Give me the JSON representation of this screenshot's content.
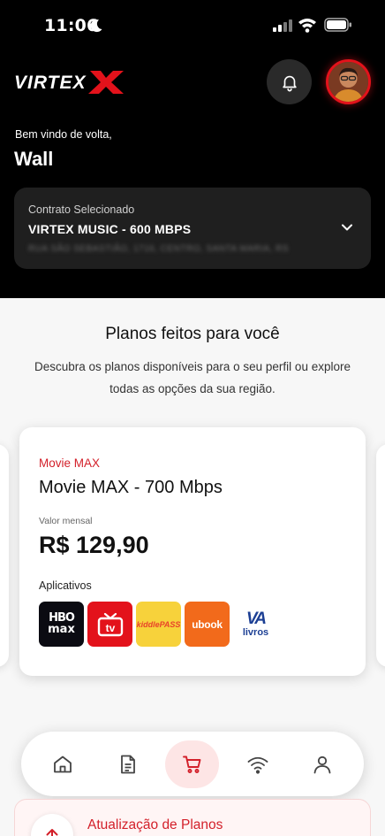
{
  "status_bar": {
    "time": "11:06"
  },
  "header": {
    "logo_text": "VIRTEX",
    "welcome": "Bem vindo de volta,",
    "user_name": "Wall"
  },
  "contract": {
    "label": "Contrato Selecionado",
    "plan": "VIRTEX MUSIC - 600 MBPS",
    "address": "RUA SÃO SEBASTIÃO, 1716, CENTRO, SANTA MARIA, RS"
  },
  "plans_section": {
    "title": "Planos feitos para você",
    "subtitle": "Descubra os planos disponíveis para o seu perfil ou explore todas as opções da sua região."
  },
  "plan_card": {
    "tag": "Movie MAX",
    "title": "Movie MAX - 700 Mbps",
    "value_label": "Valor mensal",
    "price": "R$ 129,90",
    "apps_label": "Aplicativos",
    "apps": [
      {
        "name": "HBO Max",
        "line1": "HBO",
        "line2": "max"
      },
      {
        "name": "TV",
        "glyph": "tv"
      },
      {
        "name": "kiddle",
        "text": "kiddlePASS"
      },
      {
        "name": "ubook",
        "text": "ubook"
      },
      {
        "name": "VA livros",
        "line1": "VA",
        "line2": "livros"
      }
    ]
  },
  "nav": {
    "items": [
      "home-icon",
      "document-icon",
      "cart-icon",
      "wifi-icon",
      "user-icon"
    ],
    "active": "cart-icon"
  },
  "bottom_card": {
    "title": "Atualização de Planos"
  },
  "colors": {
    "brand_red": "#e3121b",
    "accent_red": "#d3202a",
    "header_bg": "#000000"
  }
}
